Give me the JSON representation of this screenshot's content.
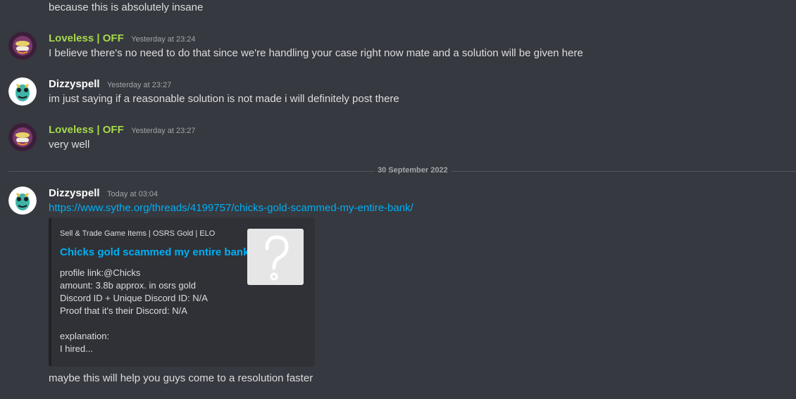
{
  "messages": [
    {
      "content": "because this is absolutely insane"
    },
    {
      "username": "Loveless | OFF",
      "timestamp": "Yesterday at 23:24",
      "content": "I believe there's no need to do that since we're handling your case right now mate and a solution will be given here"
    },
    {
      "username": "Dizzyspell",
      "timestamp": "Yesterday at 23:27",
      "content": "im just saying if a reasonable solution is not made i will definitely post there"
    },
    {
      "username": "Loveless | OFF",
      "timestamp": "Yesterday at 23:27",
      "content": "very well"
    },
    {
      "username": "Dizzyspell",
      "timestamp": "Today at 03:04",
      "link": "https://www.sythe.org/threads/4199757/chicks-gold-scammed-my-entire-bank/",
      "followup": "maybe this will help you guys come to a resolution faster"
    }
  ],
  "date_divider": "30 September 2022",
  "embed": {
    "provider": "Sell & Trade Game Items | OSRS Gold | ELO",
    "title": "Chicks gold scammed my entire bank",
    "description": "profile link:@Chicks\namount: 3.8b approx. in osrs gold\nDiscord ID + Unique Discord ID: N/A\nProof that it's their Discord: N/A\n\nexplanation:\nI hired..."
  },
  "colors": {
    "loveless_name": "#a6d94c",
    "dizzy_name": "#ffffff",
    "link": "#00aff4"
  },
  "icons": {
    "loveless_avatar": "purple-face-avatar-icon",
    "dizzy_avatar": "teal-creature-avatar-icon",
    "embed_thumb": "question-mark-icon"
  }
}
